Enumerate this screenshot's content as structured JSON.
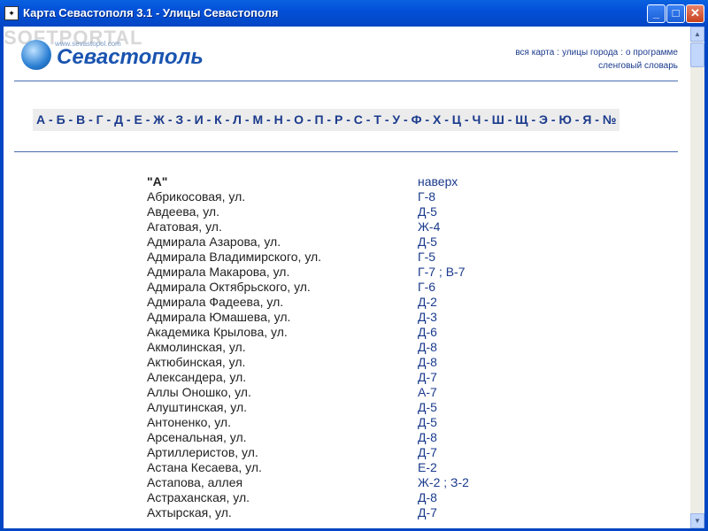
{
  "window": {
    "icon_label": "✦",
    "title": "Карта Севастополя 3.1 - Улицы Севастополя",
    "min_label": "_",
    "max_label": "□",
    "close_label": "✕"
  },
  "logo": {
    "name": "Севастополь",
    "url": "www.sevastopol.com"
  },
  "watermark": "SOFTPORTAL",
  "topnav": {
    "line1": [
      "вся карта",
      "улицы города",
      "о программе"
    ],
    "separator": ":",
    "line2": "сленговый словарь"
  },
  "alphabet": [
    "А",
    "Б",
    "В",
    "Г",
    "Д",
    "Е",
    "Ж",
    "З",
    "И",
    "К",
    "Л",
    "М",
    "Н",
    "О",
    "П",
    "Р",
    "С",
    "Т",
    "У",
    "Ф",
    "Х",
    "Ц",
    "Ч",
    "Ш",
    "Щ",
    "Э",
    "Ю",
    "Я",
    "№"
  ],
  "list": {
    "section_title": "\"А\"",
    "top_link": "наверх",
    "rows": [
      {
        "street": "Абрикосовая, ул.",
        "grid": [
          "Г-8"
        ]
      },
      {
        "street": "Авдеева, ул.",
        "grid": [
          "Д-5"
        ]
      },
      {
        "street": "Агатовая, ул.",
        "grid": [
          "Ж-4"
        ]
      },
      {
        "street": "Адмирала Азарова, ул.",
        "grid": [
          "Д-5"
        ]
      },
      {
        "street": "Адмирала Владимирского, ул.",
        "grid": [
          "Г-5"
        ]
      },
      {
        "street": "Адмирала Макарова, ул.",
        "grid": [
          "Г-7",
          "В-7"
        ]
      },
      {
        "street": "Адмирала Октябрьского, ул.",
        "grid": [
          "Г-6"
        ]
      },
      {
        "street": "Адмирала Фадеева, ул.",
        "grid": [
          "Д-2"
        ]
      },
      {
        "street": "Адмирала Юмашева, ул.",
        "grid": [
          "Д-3"
        ]
      },
      {
        "street": "Академика Крылова, ул.",
        "grid": [
          "Д-6"
        ]
      },
      {
        "street": "Акмолинская, ул.",
        "grid": [
          "Д-8"
        ]
      },
      {
        "street": "Актюбинская, ул.",
        "grid": [
          "Д-8"
        ]
      },
      {
        "street": "Александера, ул.",
        "grid": [
          "Д-7"
        ]
      },
      {
        "street": "Аллы Оношко, ул.",
        "grid": [
          "А-7"
        ]
      },
      {
        "street": "Алуштинская, ул.",
        "grid": [
          "Д-5"
        ]
      },
      {
        "street": "Антоненко, ул.",
        "grid": [
          "Д-5"
        ]
      },
      {
        "street": "Арсенальная, ул.",
        "grid": [
          "Д-8"
        ]
      },
      {
        "street": "Артиллеристов, ул.",
        "grid": [
          "Д-7"
        ]
      },
      {
        "street": "Астана Кесаева, ул.",
        "grid": [
          "Е-2"
        ]
      },
      {
        "street": "Астапова, аллея",
        "grid": [
          "Ж-2",
          "З-2"
        ]
      },
      {
        "street": "Астраханская, ул.",
        "grid": [
          "Д-8"
        ]
      },
      {
        "street": "Ахтырская, ул.",
        "grid": [
          "Д-7"
        ]
      }
    ],
    "grid_separator": ";"
  }
}
